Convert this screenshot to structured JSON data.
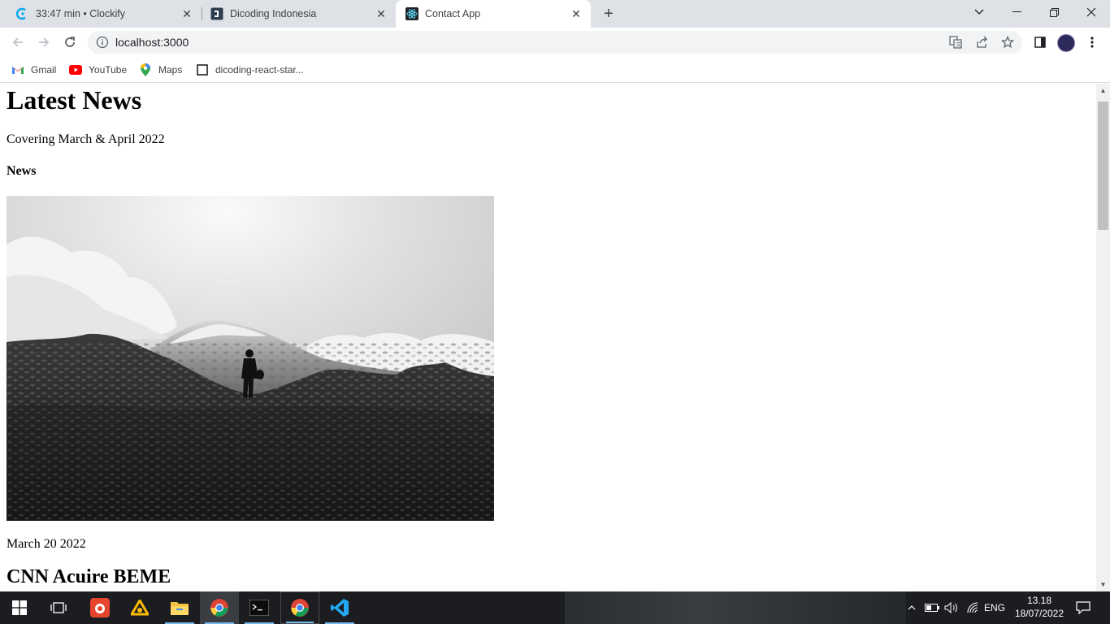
{
  "browser": {
    "tabs": [
      {
        "title": "33:47 min • Clockify",
        "active": false,
        "favicon": "clockify-icon"
      },
      {
        "title": "Dicoding Indonesia",
        "active": false,
        "favicon": "dicoding-icon"
      },
      {
        "title": "Contact App",
        "active": true,
        "favicon": "react-icon"
      }
    ],
    "url": "localhost:3000",
    "bookmarks": [
      {
        "label": "Gmail",
        "icon": "gmail-icon"
      },
      {
        "label": "YouTube",
        "icon": "youtube-icon"
      },
      {
        "label": "Maps",
        "icon": "maps-icon"
      },
      {
        "label": "dicoding-react-star...",
        "icon": "page-icon"
      }
    ]
  },
  "page": {
    "title": "Latest News",
    "covering": "Covering March & April 2022",
    "section": "News",
    "image_alt": "Black and white photo of a person standing on rocky terrain in front of a snowy mountain",
    "article_date": "March 20 2022",
    "article_title": "CNN Acuire BEME"
  },
  "taskbar": {
    "apps": [
      "start-icon",
      "task-view-icon",
      "app-icon",
      "drive-icon",
      "file-explorer-icon",
      "chrome-icon",
      "terminal-icon",
      "chrome-icon",
      "vscode-icon"
    ],
    "language": "ENG",
    "time": "13.18",
    "date": "18/07/2022"
  },
  "colors": {
    "tabstrip": "#dee1e6",
    "omnibox": "#f1f3f4",
    "taskbar": "#1b1d20",
    "vscode_blue": "#23a9f2"
  }
}
